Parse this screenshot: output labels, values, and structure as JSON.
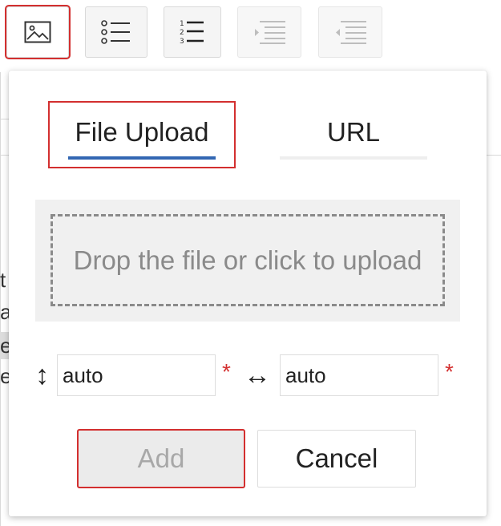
{
  "toolbar": {
    "buttons": [
      {
        "icon": "image-icon",
        "state": "active"
      },
      {
        "icon": "bulleted-list-icon",
        "state": "normal"
      },
      {
        "icon": "numbered-list-icon",
        "state": "normal"
      },
      {
        "icon": "indent-icon",
        "state": "disabled"
      },
      {
        "icon": "outdent-icon",
        "state": "disabled"
      }
    ]
  },
  "background_text": {
    "lines": [
      "t",
      "a",
      "e",
      "e"
    ]
  },
  "dialog": {
    "tabs": [
      {
        "label": "File Upload",
        "selected": true
      },
      {
        "label": "URL",
        "selected": false
      }
    ],
    "dropzone_text": "Drop the file or click to upload",
    "height_icon": "↕",
    "width_icon": "↔",
    "height_value": "auto",
    "width_value": "auto",
    "required_mark": "*",
    "add_label": "Add",
    "cancel_label": "Cancel"
  },
  "colors": {
    "highlight": "#d32f2f",
    "tab_underline": "#3367b3",
    "required": "#d32f2f"
  }
}
